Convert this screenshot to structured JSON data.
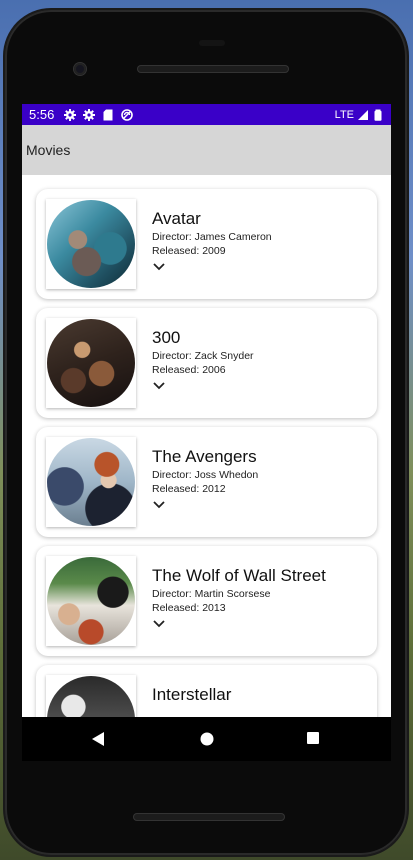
{
  "status": {
    "time": "5:56",
    "network": "LTE"
  },
  "app_bar": {
    "title": "Movies"
  },
  "labels": {
    "director_prefix": "Director: ",
    "released_prefix": "Released: "
  },
  "movies": [
    {
      "title": "Avatar",
      "director": "James Cameron",
      "released": "2009"
    },
    {
      "title": "300",
      "director": "Zack Snyder",
      "released": "2006"
    },
    {
      "title": "The Avengers",
      "director": "Joss Whedon",
      "released": "2012"
    },
    {
      "title": "The Wolf of Wall Street",
      "director": "Martin Scorsese",
      "released": "2013"
    },
    {
      "title": "Interstellar"
    }
  ],
  "colors": {
    "status_bar": "#3a00c8",
    "app_bar": "#d6d6d6"
  },
  "icons": [
    "settings-icon",
    "settings-icon",
    "sd-card-icon",
    "sync-icon",
    "signal-icon",
    "battery-icon",
    "chevron-down-icon",
    "back-icon",
    "home-icon",
    "recents-icon"
  ]
}
